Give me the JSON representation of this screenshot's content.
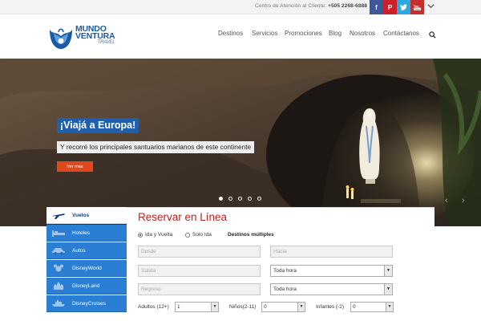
{
  "topbar": {
    "contact_label": "Centro de Atención al Cliente:",
    "contact_phone": "+505 2268-6888"
  },
  "logo": {
    "line1": "MUNDO",
    "line2": "VENTURA",
    "line3": "TRAVEL"
  },
  "nav": {
    "items": [
      "Destinos",
      "Servicios",
      "Promociones",
      "Blog",
      "Nosotros",
      "Contáctanos"
    ]
  },
  "hero": {
    "title": "¡Viajá a Europa!",
    "subtitle": "Y recorré los principales santuarios marianos de este continente",
    "button": "Ver mas",
    "slides": 5,
    "active_slide": 1
  },
  "booking": {
    "title": "Reservar en Línea",
    "tabs": [
      {
        "label": "Vuelos",
        "icon": "plane-icon",
        "active": true
      },
      {
        "label": "Hoteles",
        "icon": "bed-icon",
        "active": false
      },
      {
        "label": "Autos",
        "icon": "car-icon",
        "active": false
      },
      {
        "label": "DisneyWorld",
        "icon": "mickey-icon",
        "active": false
      },
      {
        "label": "DisneyLand",
        "icon": "castle-icon",
        "active": false
      },
      {
        "label": "DisneyCruises",
        "icon": "ship-icon",
        "active": false
      }
    ],
    "trip_types": {
      "round_trip": "Ida y Vuelta",
      "one_way": "Solo Ida",
      "multi": "Destinos múltiples",
      "selected": "round_trip"
    },
    "fields": {
      "from_placeholder": "Desde",
      "to_placeholder": "Hacia",
      "depart_placeholder": "Salida",
      "return_placeholder": "Regreso",
      "depart_time": "Toda hora",
      "return_time": "Toda hora"
    },
    "passengers": {
      "adults_label": "Adultos (12+)",
      "adults_value": "1",
      "children_label": "Niños(2-11)",
      "children_value": "0",
      "infants_label": "Infantes (-2)",
      "infants_value": "0"
    }
  },
  "colors": {
    "brand_blue": "#1e5fae",
    "tab_blue": "#2a7fd4",
    "title_red": "#c21f1f",
    "button_orange": "#e0491e"
  }
}
